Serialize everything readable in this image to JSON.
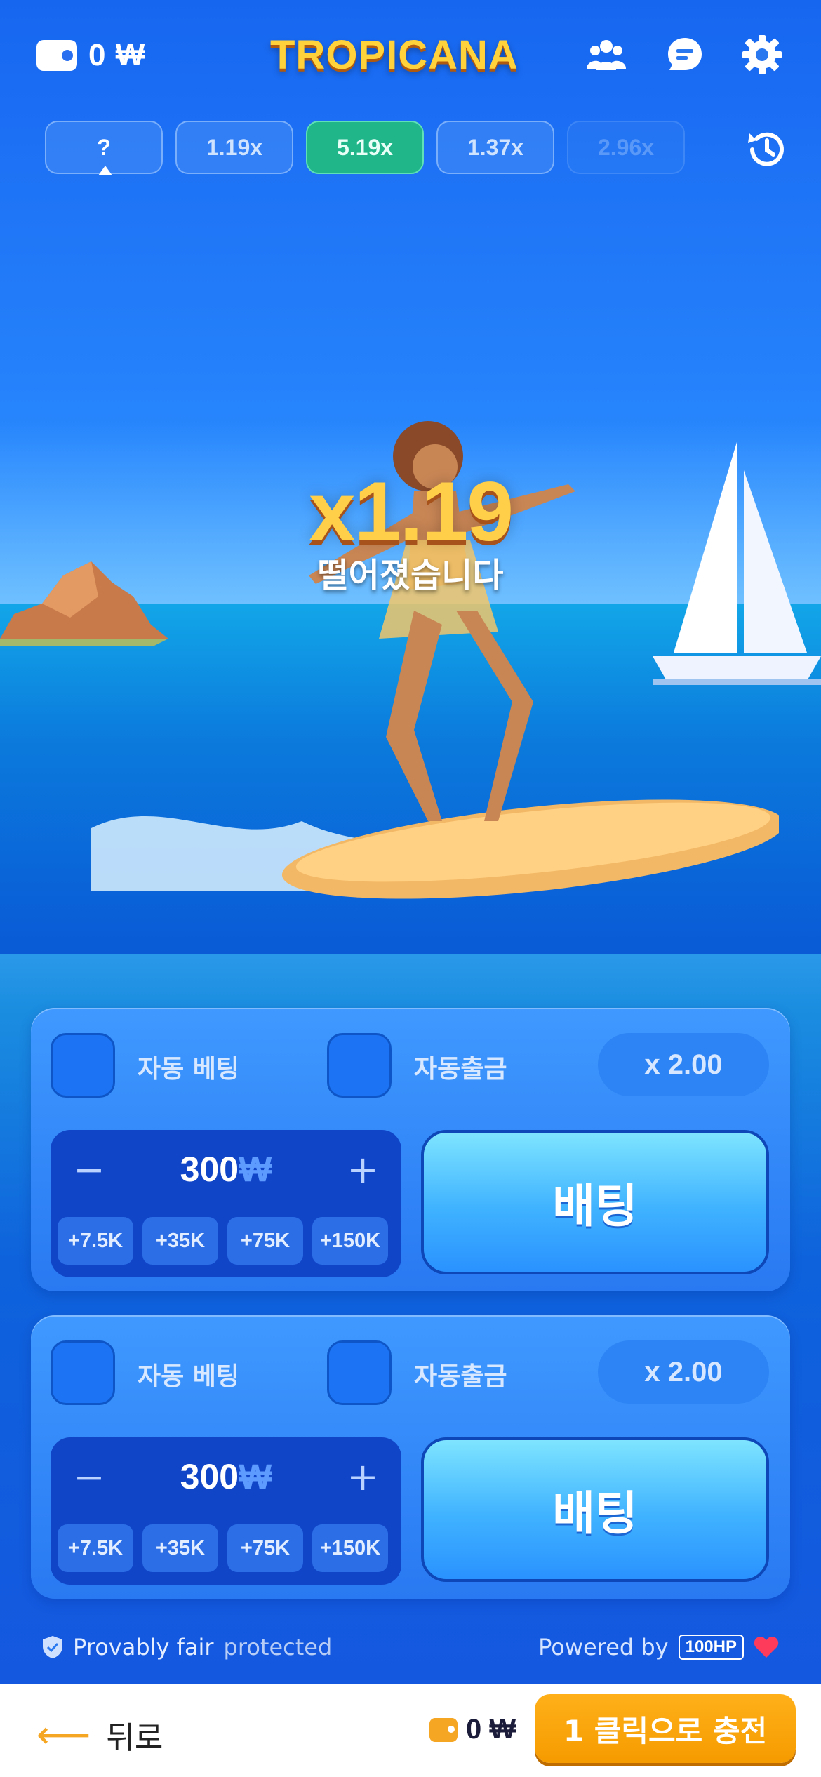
{
  "header": {
    "balance": "0 ₩",
    "logo": "TROPICANA",
    "icons": [
      "wallet-icon",
      "players-icon",
      "chat-icon",
      "settings-icon"
    ]
  },
  "history": {
    "chips": [
      {
        "label": "?",
        "state": "active"
      },
      {
        "label": "1.19x",
        "state": "normal"
      },
      {
        "label": "5.19x",
        "state": "green"
      },
      {
        "label": "1.37x",
        "state": "normal"
      },
      {
        "label": "2.96x",
        "state": "faded"
      }
    ],
    "history_icon": "history-icon"
  },
  "game": {
    "multiplier": "x1.19",
    "status": "떨어졌습니다"
  },
  "bet_panels": [
    {
      "auto_bet_label": "자동 베팅",
      "auto_cashout_label": "자동출금",
      "cashout_multiplier": "x 2.00",
      "amount": "300",
      "currency": "₩",
      "minus": "−",
      "plus": "+",
      "quick": [
        "+7.5K",
        "+35K",
        "+75K",
        "+150K"
      ],
      "bet_label": "배팅"
    },
    {
      "auto_bet_label": "자동 베팅",
      "auto_cashout_label": "자동출금",
      "cashout_multiplier": "x 2.00",
      "amount": "300",
      "currency": "₩",
      "minus": "−",
      "plus": "+",
      "quick": [
        "+7.5K",
        "+35K",
        "+75K",
        "+150K"
      ],
      "bet_label": "배팅"
    }
  ],
  "footer": {
    "provably": "Provably fair",
    "protected": "protected",
    "powered_by": "Powered by",
    "provider": "100HP"
  },
  "bottom_bar": {
    "back_label": "뒤로",
    "balance": "0 ₩",
    "charge_label": "1 클릭으로 충전"
  },
  "colors": {
    "accent_gold": "#ffcf4a",
    "bet_button": "#3fb2ff",
    "charge_button": "#f5a623",
    "win_chip": "#21b58a"
  }
}
